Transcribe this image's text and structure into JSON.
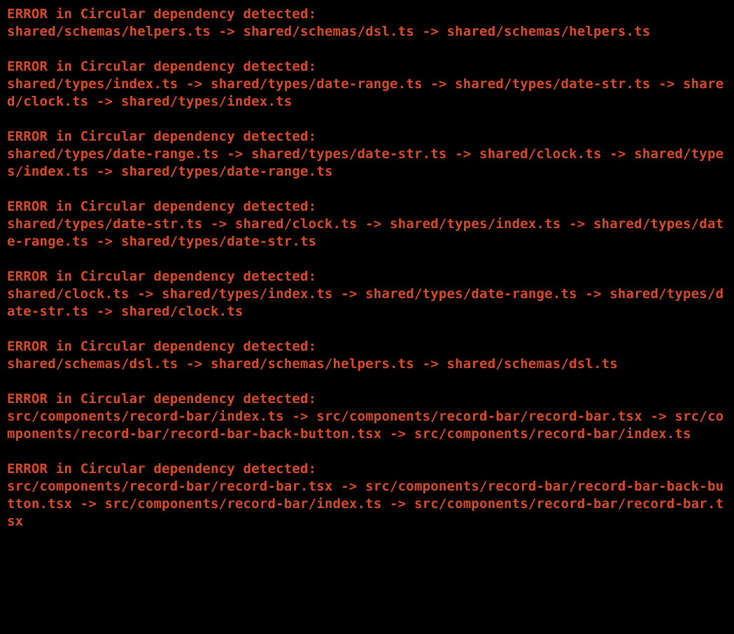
{
  "terminal": {
    "fg_color": "#d84c2b",
    "bg_color": "#000000",
    "errors": [
      {
        "header": "ERROR in Circular dependency detected:",
        "body": "shared/schemas/helpers.ts -> shared/schemas/dsl.ts -> shared/schemas/helpers.ts"
      },
      {
        "header": "ERROR in Circular dependency detected:",
        "body": "shared/types/index.ts -> shared/types/date-range.ts -> shared/types/date-str.ts -> shared/clock.ts -> shared/types/index.ts"
      },
      {
        "header": "ERROR in Circular dependency detected:",
        "body": "shared/types/date-range.ts -> shared/types/date-str.ts -> shared/clock.ts -> shared/types/index.ts -> shared/types/date-range.ts"
      },
      {
        "header": "ERROR in Circular dependency detected:",
        "body": "shared/types/date-str.ts -> shared/clock.ts -> shared/types/index.ts -> shared/types/date-range.ts -> shared/types/date-str.ts"
      },
      {
        "header": "ERROR in Circular dependency detected:",
        "body": "shared/clock.ts -> shared/types/index.ts -> shared/types/date-range.ts -> shared/types/date-str.ts -> shared/clock.ts"
      },
      {
        "header": "ERROR in Circular dependency detected:",
        "body": "shared/schemas/dsl.ts -> shared/schemas/helpers.ts -> shared/schemas/dsl.ts"
      },
      {
        "header": "ERROR in Circular dependency detected:",
        "body": "src/components/record-bar/index.ts -> src/components/record-bar/record-bar.tsx -> src/components/record-bar/record-bar-back-button.tsx -> src/components/record-bar/index.ts"
      },
      {
        "header": "ERROR in Circular dependency detected:",
        "body": "src/components/record-bar/record-bar.tsx -> src/components/record-bar/record-bar-back-button.tsx -> src/components/record-bar/index.ts -> src/components/record-bar/record-bar.tsx"
      }
    ]
  }
}
